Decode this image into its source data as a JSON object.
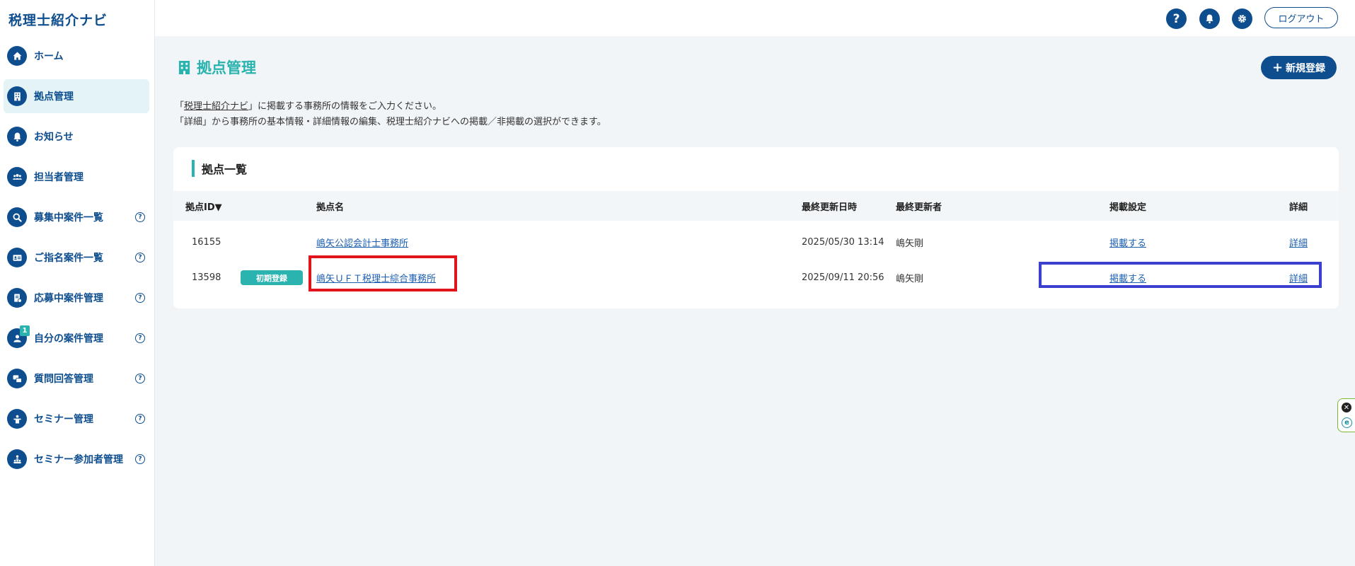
{
  "app": {
    "brand": "税理士紹介ナビ"
  },
  "sidebar": {
    "items": [
      {
        "label": "ホーム",
        "icon": "home-icon",
        "help": false,
        "active": false
      },
      {
        "label": "拠点管理",
        "icon": "building-icon",
        "help": false,
        "active": true
      },
      {
        "label": "お知らせ",
        "icon": "bell-icon",
        "help": false,
        "active": false
      },
      {
        "label": "担当者管理",
        "icon": "people-icon",
        "help": false,
        "active": false
      },
      {
        "label": "募集中案件一覧",
        "icon": "search-icon",
        "help": true,
        "active": false
      },
      {
        "label": "ご指名案件一覧",
        "icon": "id-card-icon",
        "help": true,
        "active": false
      },
      {
        "label": "応募中案件管理",
        "icon": "document-icon",
        "help": true,
        "active": false
      },
      {
        "label": "自分の案件管理",
        "icon": "person-icon",
        "help": true,
        "active": false,
        "badge": "1"
      },
      {
        "label": "質問回答管理",
        "icon": "chat-icon",
        "help": true,
        "active": false
      },
      {
        "label": "セミナー管理",
        "icon": "presenter-icon",
        "help": true,
        "active": false
      },
      {
        "label": "セミナー参加者管理",
        "icon": "audience-icon",
        "help": true,
        "active": false
      }
    ],
    "help_glyph": "?"
  },
  "header": {
    "help_icon": "?",
    "logout_label": "ログアウト"
  },
  "main": {
    "title": "拠点管理",
    "new_button_label": "新規登録",
    "intro_line1_pre": "「",
    "intro_line1_link": "税理士紹介ナビ",
    "intro_line1_post": "」に掲載する事務所の情報をご入力ください。",
    "intro_line2": "「詳細」から事務所の基本情報・詳細情報の編集、税理士紹介ナビへの掲載／非掲載の選択ができます。",
    "card_title": "拠点一覧",
    "columns": {
      "id": "拠点ID▼",
      "name": "拠点名",
      "updated_at": "最終更新日時",
      "updated_by": "最終更新者",
      "publish": "掲載設定",
      "detail": "詳細"
    },
    "rows": [
      {
        "id": "16155",
        "badge": "",
        "name": "嶋矢公認会計士事務所",
        "updated_at": "2025/05/30 13:14",
        "updated_by": "嶋矢剛",
        "publish": "掲載する",
        "detail": "詳細"
      },
      {
        "id": "13598",
        "badge": "初期登録",
        "name": "嶋矢ＵＦＴ税理士綜合事務所",
        "updated_at": "2025/09/11 20:56",
        "updated_by": "嶋矢剛",
        "publish": "掲載する",
        "detail": "詳細"
      }
    ]
  },
  "colors": {
    "primary": "#0e4e8f",
    "accent": "#2bb3b0",
    "link": "#1c5fb0",
    "highlight_red": "#e0141b",
    "highlight_blue": "#3b3fd0"
  },
  "widget": {
    "close_glyph": "✕",
    "e_glyph": "e"
  }
}
